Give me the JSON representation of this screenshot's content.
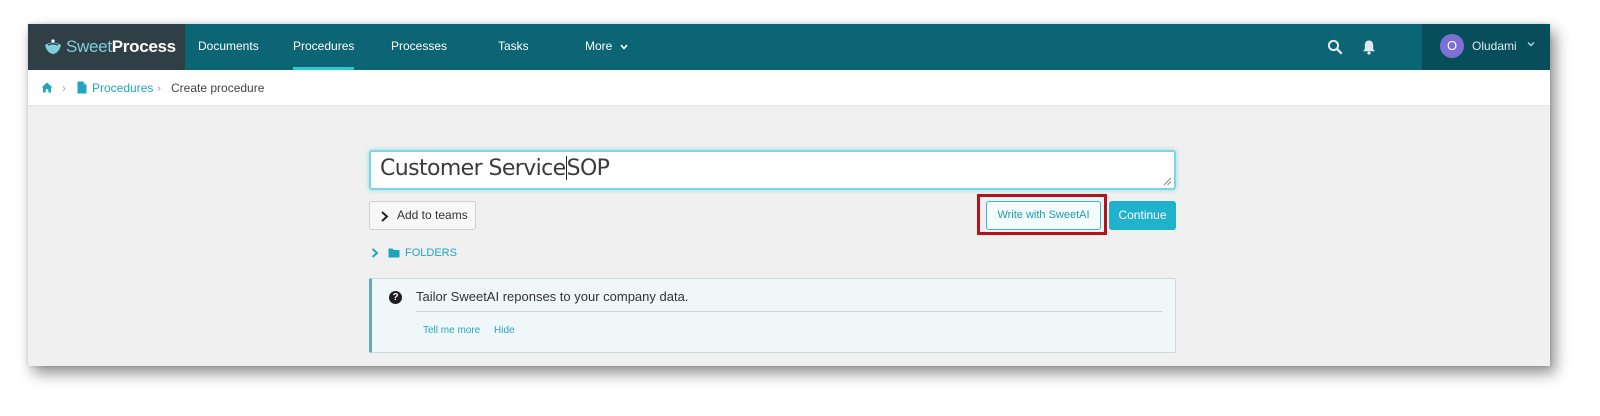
{
  "brand": {
    "name_part1": "Sweet",
    "name_part2": "Process",
    "accent": "#0b6574"
  },
  "nav": {
    "items": [
      {
        "label": "Documents"
      },
      {
        "label": "Procedures",
        "active": true
      },
      {
        "label": "Processes"
      },
      {
        "label": "Tasks"
      },
      {
        "label": "More"
      }
    ]
  },
  "topbar": {
    "search_icon": "search-icon",
    "bell_icon": "bell-icon"
  },
  "user": {
    "initial": "O",
    "name": "Oludami"
  },
  "breadcrumb": {
    "home_icon": "home-icon",
    "items": [
      "Procedures",
      "Create procedure"
    ]
  },
  "form": {
    "title_before_cursor": "Customer Service",
    "title_after_cursor": "SOP",
    "add_teams_label": "Add to teams",
    "write_ai_label": "Write with SweetAI",
    "continue_label": "Continue",
    "folders_label": "FOLDERS"
  },
  "info": {
    "message": "Tailor SweetAI reponses to your company data.",
    "tell_more": "Tell me more",
    "hide": "Hide"
  },
  "colors": {
    "highlight_box": "#b0141e",
    "primary_button": "#1eb2cc",
    "link": "#1fa6bd"
  }
}
